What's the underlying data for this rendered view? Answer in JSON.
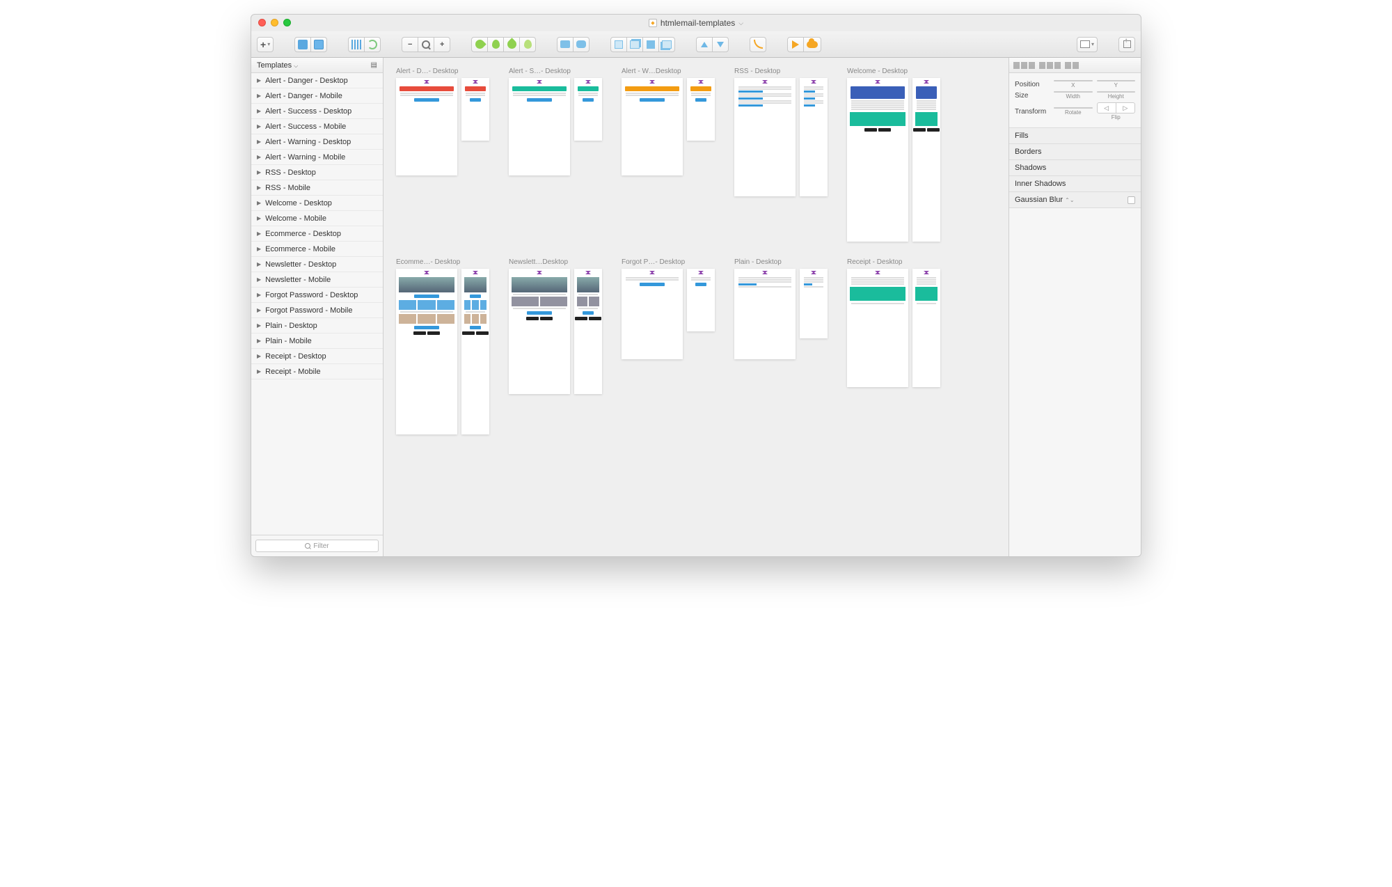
{
  "window": {
    "title": "htmlemail-templates",
    "doc_icon": "◆"
  },
  "sidebar": {
    "header": "Templates",
    "filter_placeholder": "Filter",
    "items": [
      "Alert - Danger - Desktop",
      "Alert - Danger - Mobile",
      "Alert - Success - Desktop",
      "Alert - Success - Mobile",
      "Alert - Warning - Desktop",
      "Alert - Warning - Mobile",
      "RSS - Desktop",
      "RSS - Mobile",
      "Welcome - Desktop",
      "Welcome - Mobile",
      "Ecommerce - Desktop",
      "Ecommerce - Mobile",
      "Newsletter - Desktop",
      "Newsletter - Mobile",
      "Forgot Password - Desktop",
      "Forgot Password - Mobile",
      "Plain - Desktop",
      "Plain - Mobile",
      "Receipt - Desktop",
      "Receipt - Mobile"
    ]
  },
  "canvas": {
    "row1": [
      {
        "label": "Alert - D…- Desktop",
        "variant": "alert",
        "color": "#e74c3c",
        "h1": 140,
        "h2": 90
      },
      {
        "label": "Alert - S…- Desktop",
        "variant": "alert",
        "color": "#1abc9c",
        "h1": 140,
        "h2": 90
      },
      {
        "label": "Alert - W…Desktop",
        "variant": "alert",
        "color": "#f39c12",
        "h1": 140,
        "h2": 90
      },
      {
        "label": "RSS - Desktop",
        "variant": "rss",
        "color": "#3498db",
        "h1": 170,
        "h2": 170
      },
      {
        "label": "Welcome - Desktop",
        "variant": "welcome",
        "color": "#1abc9c",
        "h1": 235,
        "h2": 235
      }
    ],
    "row2": [
      {
        "label": "Ecomme…- Desktop",
        "variant": "ecom",
        "color": "#3498db",
        "h1": 238,
        "h2": 238
      },
      {
        "label": "Newslett…Desktop",
        "variant": "news",
        "color": "#3498db",
        "h1": 180,
        "h2": 180
      },
      {
        "label": "Forgot P…- Desktop",
        "variant": "forgot",
        "color": "#3498db",
        "h1": 130,
        "h2": 90
      },
      {
        "label": "Plain - Desktop",
        "variant": "plain",
        "color": "#3498db",
        "h1": 130,
        "h2": 100
      },
      {
        "label": "Receipt - Desktop",
        "variant": "receipt",
        "color": "#1abc9c",
        "h1": 170,
        "h2": 170
      }
    ]
  },
  "inspector": {
    "position_label": "Position",
    "x_label": "X",
    "y_label": "Y",
    "size_label": "Size",
    "width_label": "Width",
    "height_label": "Height",
    "transform_label": "Transform",
    "rotate_label": "Rotate",
    "flip_label": "Flip",
    "sections": {
      "fills": "Fills",
      "borders": "Borders",
      "shadows": "Shadows",
      "inner_shadows": "Inner Shadows",
      "gaussian_blur": "Gaussian Blur"
    }
  }
}
